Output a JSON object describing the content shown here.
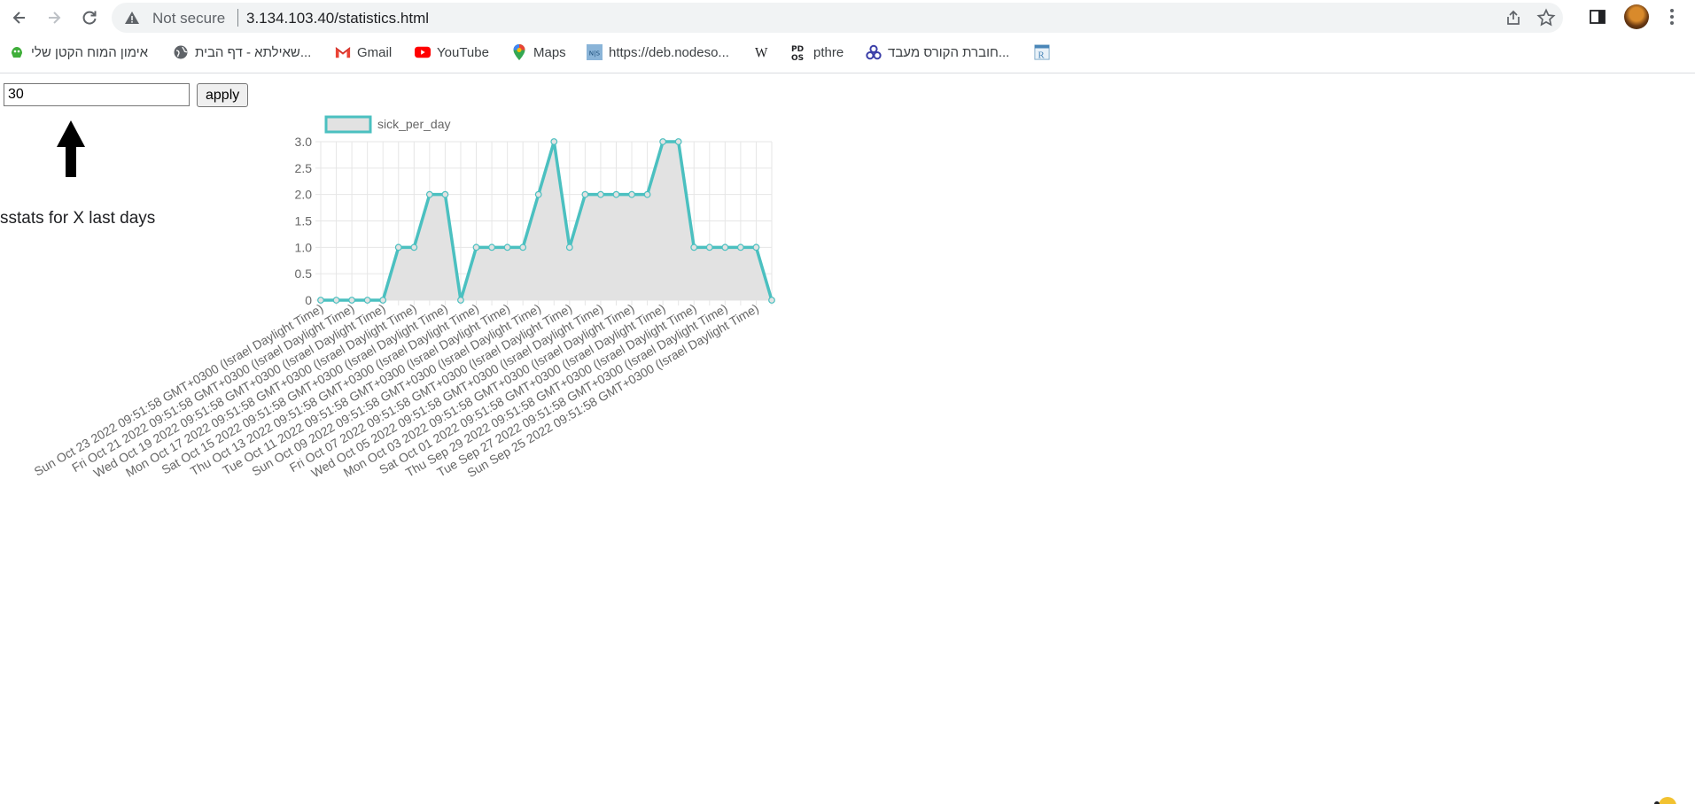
{
  "browser": {
    "security_text": "Not secure",
    "url": "3.134.103.40/statistics.html"
  },
  "bookmarks": [
    {
      "label": "אימון המוח הקטן שלי",
      "icon": "green-creature-icon"
    },
    {
      "label": "שאילתא - דף הבית...",
      "icon": "globe-icon"
    },
    {
      "label": "Gmail",
      "icon": "gmail-icon"
    },
    {
      "label": "YouTube",
      "icon": "youtube-icon"
    },
    {
      "label": "Maps",
      "icon": "maps-pin-icon"
    },
    {
      "label": "https://deb.nodeso...",
      "icon": "nodesource-icon"
    },
    {
      "label": "",
      "icon": "wikipedia-icon"
    },
    {
      "label": "pthre",
      "icon": "pdos-icon"
    },
    {
      "label": "חוברת הקורס מעבד...",
      "icon": "tri-circle-icon"
    },
    {
      "label": "",
      "icon": "r-doc-icon"
    }
  ],
  "page": {
    "days_value": "30",
    "apply_label": "apply",
    "caption": "sstats for X last days"
  },
  "chart_data": {
    "type": "line",
    "series": [
      {
        "name": "sick_per_day",
        "color": "#4bc0c0",
        "fill": "#e2e2e2",
        "values": [
          0,
          0,
          0,
          0,
          0,
          1,
          1,
          2,
          2,
          0,
          1,
          1,
          1,
          1,
          2,
          3,
          1,
          2,
          2,
          2,
          2,
          2,
          3,
          3,
          1,
          1,
          1,
          1,
          1,
          0
        ]
      }
    ],
    "x_tick_labels": [
      "Sun Oct 23 2022 09:51:58 GMT+0300 (Israel Daylight Time)",
      "Fri Oct 21 2022 09:51:58 GMT+0300 (Israel Daylight Time)",
      "Wed Oct 19 2022 09:51:58 GMT+0300 (Israel Daylight Time)",
      "Mon Oct 17 2022 09:51:58 GMT+0300 (Israel Daylight Time)",
      "Sat Oct 15 2022 09:51:58 GMT+0300 (Israel Daylight Time)",
      "Thu Oct 13 2022 09:51:58 GMT+0300 (Israel Daylight Time)",
      "Tue Oct 11 2022 09:51:58 GMT+0300 (Israel Daylight Time)",
      "Sun Oct 09 2022 09:51:58 GMT+0300 (Israel Daylight Time)",
      "Fri Oct 07 2022 09:51:58 GMT+0300 (Israel Daylight Time)",
      "Wed Oct 05 2022 09:51:58 GMT+0300 (Israel Daylight Time)",
      "Mon Oct 03 2022 09:51:58 GMT+0300 (Israel Daylight Time)",
      "Sat Oct 01 2022 09:51:58 GMT+0300 (Israel Daylight Time)",
      "Thu Sep 29 2022 09:51:58 GMT+0300 (Israel Daylight Time)",
      "Tue Sep 27 2022 09:51:58 GMT+0300 (Israel Daylight Time)",
      "Sun Sep 25 2022 09:51:58 GMT+0300 (Israel Daylight Time)"
    ],
    "y_tick_labels": [
      "0",
      "0.5",
      "1.0",
      "1.5",
      "2.0",
      "2.5",
      "3.0"
    ],
    "ylim": [
      0,
      3
    ],
    "grid": true,
    "legend_placement": "top"
  }
}
